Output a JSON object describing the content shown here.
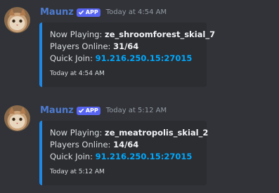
{
  "messages": [
    {
      "username": "Maunz",
      "badge": "APP",
      "timestamp": "Today at 4:54 AM",
      "embed": {
        "now_playing_label": "Now Playing:",
        "now_playing_value": "ze_shroomforest_skial_7",
        "players_label": "Players Online:",
        "players_value": "31/64",
        "quick_join_label": "Quick Join:",
        "quick_join_value": "91.216.250.15:27015",
        "footer": "Today at 4:54 AM"
      }
    },
    {
      "username": "Maunz",
      "badge": "APP",
      "timestamp": "Today at 5:12 AM",
      "embed": {
        "now_playing_label": "Now Playing:",
        "now_playing_value": "ze_meatropolis_skial_2",
        "players_label": "Players Online:",
        "players_value": "14/64",
        "quick_join_label": "Quick Join:",
        "quick_join_value": "91.216.250.15:27015",
        "footer": "Today at 5:12 AM"
      }
    }
  ],
  "colors": {
    "background": "#313338",
    "embed_background": "#2b2d31",
    "embed_accent": "#1e88e5",
    "username": "#4e7bd1",
    "badge": "#5865f2",
    "link": "#00a8fc"
  },
  "icons": {
    "badge_icon": "checkmark-icon",
    "avatar": "cat-avatar"
  }
}
